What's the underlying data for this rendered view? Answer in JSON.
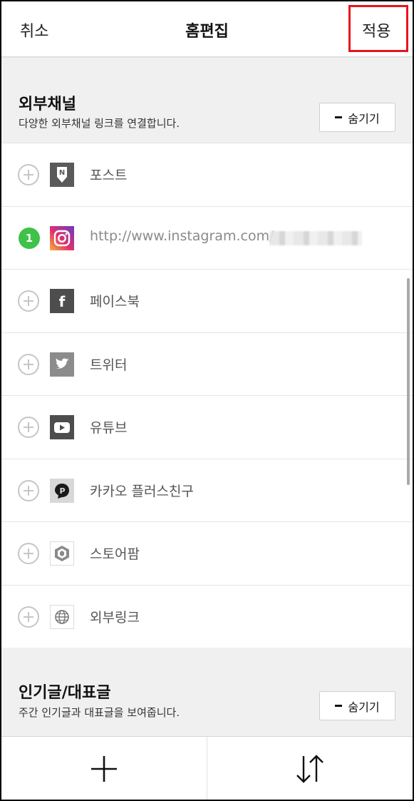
{
  "header": {
    "cancel_label": "취소",
    "title": "홈편집",
    "apply_label": "적용"
  },
  "external_section": {
    "title": "외부채널",
    "description": "다양한 외부채널 링크를 연결합니다.",
    "hide_label": "숨기기"
  },
  "channels": [
    {
      "label": "포스트",
      "icon": "naver-post-icon",
      "state": "add"
    },
    {
      "label": "http://www.instagram.com/",
      "icon": "instagram-icon",
      "state": "added",
      "order": "1"
    },
    {
      "label": "페이스북",
      "icon": "facebook-icon",
      "state": "add"
    },
    {
      "label": "트위터",
      "icon": "twitter-icon",
      "state": "add"
    },
    {
      "label": "유튜브",
      "icon": "youtube-icon",
      "state": "add"
    },
    {
      "label": "카카오 플러스친구",
      "icon": "kakao-plusfriend-icon",
      "state": "add"
    },
    {
      "label": "스토어팜",
      "icon": "storefarm-icon",
      "state": "add"
    },
    {
      "label": "외부링크",
      "icon": "globe-icon",
      "state": "add"
    }
  ],
  "popular_section": {
    "title": "인기글/대표글",
    "description": "주간 인기글과 대표글을 보여줍니다.",
    "hide_label": "숨기기"
  },
  "bottom_bar": {
    "add_icon": "plus-icon",
    "sort_icon": "sort-arrows-icon"
  },
  "colors": {
    "highlight": "#e8141b",
    "badge_green": "#3ec247",
    "background": "#f0f0f0"
  }
}
